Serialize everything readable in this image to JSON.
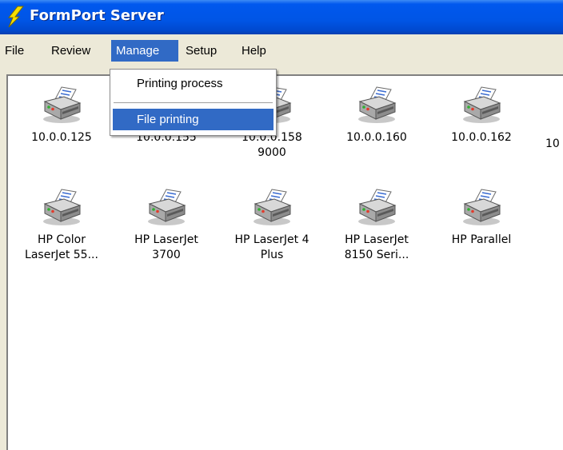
{
  "window": {
    "title": "FormPort Server",
    "icon": "lightning-bolt-icon"
  },
  "menubar": {
    "items": [
      {
        "label": "File"
      },
      {
        "label": "Review"
      },
      {
        "label": "Manage"
      },
      {
        "label": "Setup"
      },
      {
        "label": "Help"
      }
    ]
  },
  "manage_menu": {
    "items": [
      {
        "label": "Printing process"
      },
      {
        "label": "File printing"
      }
    ]
  },
  "printers": {
    "row1": [
      {
        "line1": "10.0.0.125",
        "line2": ""
      },
      {
        "line1": "10.0.0.155",
        "line2": ""
      },
      {
        "line1": "10.0.0.158",
        "line2": "9000"
      },
      {
        "line1": "10.0.0.160",
        "line2": ""
      },
      {
        "line1": "10.0.0.162",
        "line2": ""
      },
      {
        "line1": "10",
        "line2": ""
      }
    ],
    "row2": [
      {
        "line1": "HP Color",
        "line2": "LaserJet 55..."
      },
      {
        "line1": "HP LaserJet",
        "line2": "3700"
      },
      {
        "line1": "HP LaserJet 4",
        "line2": "Plus"
      },
      {
        "line1": "HP LaserJet",
        "line2": "8150 Seri..."
      },
      {
        "line1": "HP Parallel",
        "line2": ""
      }
    ]
  },
  "colors": {
    "titlebar": "#0055e5",
    "highlight": "#316ac5",
    "bolt": "#f5e000"
  }
}
